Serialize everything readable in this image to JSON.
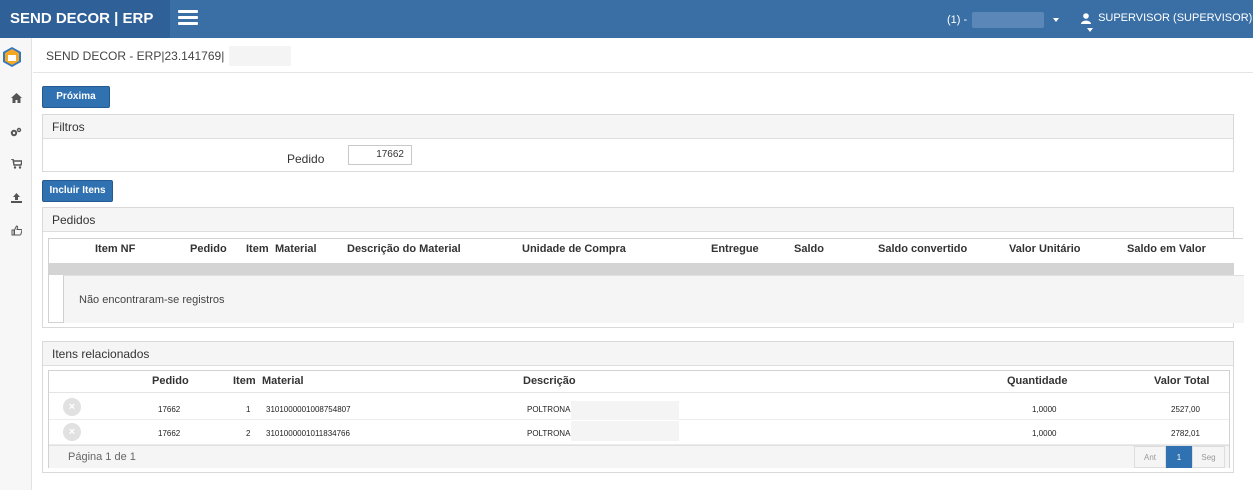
{
  "topbar": {
    "brand": "SEND DECOR | ERP",
    "company_prefix": "(1) -",
    "user": "SUPERVISOR (SUPERVISOR)"
  },
  "page_header": {
    "title": "SEND DECOR - ERP|23.141769|"
  },
  "toolbar": {
    "next_label": "Próxima"
  },
  "filters": {
    "title": "Filtros",
    "pedido_label": "Pedido",
    "pedido_value": "17662"
  },
  "include_label": "Incluir Itens",
  "orders": {
    "title": "Pedidos",
    "columns": [
      "Item NF",
      "Pedido",
      "Item",
      "Material",
      "Descrição do Material",
      "Unidade de Compra",
      "Entregue",
      "Saldo",
      "Saldo convertido",
      "Valor Unitário",
      "Saldo em Valor"
    ],
    "empty_text": "Não encontraram-se registros"
  },
  "related": {
    "title": "Itens relacionados",
    "columns": [
      "Pedido",
      "Item",
      "Material",
      "Descrição",
      "Quantidade",
      "Valor Total"
    ],
    "rows": [
      {
        "pedido": "17662",
        "item": "1",
        "material": "3101000001008754807",
        "descricao": "POLTRONA",
        "quantidade": "1,0000",
        "valor_total": "2527,00"
      },
      {
        "pedido": "17662",
        "item": "2",
        "material": "3101000001011834766",
        "descricao": "POLTRONA",
        "quantidade": "1,0000",
        "valor_total": "2782,01"
      }
    ],
    "pagination": {
      "summary": "Página 1 de 1",
      "prev": "Ant",
      "current": "1",
      "next": "Seg"
    }
  },
  "colors": {
    "topbar": "#3a6fa6",
    "brand_bg": "#2f6098",
    "primary_button": "#3071b1"
  },
  "icons": [
    "menu-icon",
    "user-icon",
    "caret-down-icon",
    "logo-icon",
    "home-icon",
    "gears-icon",
    "cart-icon",
    "upload-icon",
    "thumbs-up-icon",
    "remove-icon"
  ]
}
